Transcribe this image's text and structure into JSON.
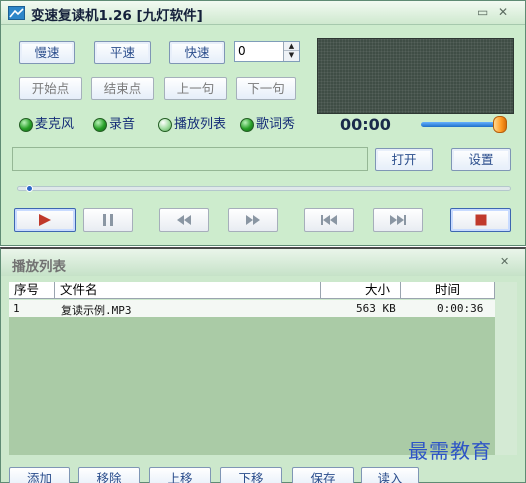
{
  "window": {
    "title": "变速复读机1.26 [九灯软件]",
    "minimize_icon": "minimize-icon",
    "close_icon": "close-icon",
    "app_icon": "mountain-icon"
  },
  "speed_buttons": {
    "slow": "慢速",
    "normal": "平速",
    "fast": "快速"
  },
  "speed_spinner": {
    "value": "0"
  },
  "segment_buttons": {
    "start_point": "开始点",
    "end_point": "结束点",
    "prev_sentence": "上一句",
    "next_sentence": "下一句"
  },
  "options": [
    {
      "label": "麦克风",
      "state": "on"
    },
    {
      "label": "录音",
      "state": "on"
    },
    {
      "label": "播放列表",
      "state": "off"
    },
    {
      "label": "歌词秀",
      "state": "on"
    }
  ],
  "timer": "00:00",
  "volume": {
    "level": 0.95
  },
  "file_path": {
    "value": ""
  },
  "file_buttons": {
    "open": "打开",
    "settings": "设置"
  },
  "seek": {
    "position": 0.02
  },
  "transport": [
    {
      "name": "play-button",
      "icon": "play-icon"
    },
    {
      "name": "pause-button",
      "icon": "pause-icon"
    },
    {
      "name": "rewind-button",
      "icon": "rewind-icon"
    },
    {
      "name": "fast-forward-button",
      "icon": "fast-forward-icon"
    },
    {
      "name": "previous-track-button",
      "icon": "previous-icon"
    },
    {
      "name": "next-track-button",
      "icon": "next-icon"
    },
    {
      "name": "stop-button",
      "icon": "stop-icon"
    }
  ],
  "playlist": {
    "title": "播放列表",
    "columns": [
      "序号",
      "文件名",
      "大小",
      "时间"
    ],
    "rows": [
      {
        "index": "1",
        "filename": "复读示例.MP3",
        "size": "563 KB",
        "time": "0:00:36"
      }
    ],
    "buttons": [
      "添加",
      "移除",
      "上移",
      "下移",
      "保存",
      "读入"
    ]
  },
  "watermark": "最需教育",
  "colors": {
    "window_bg": "#cdeccd",
    "accent_blue": "#2a4d8c",
    "display_bg": "#3f4d45",
    "list_bg": "#aacba6"
  }
}
